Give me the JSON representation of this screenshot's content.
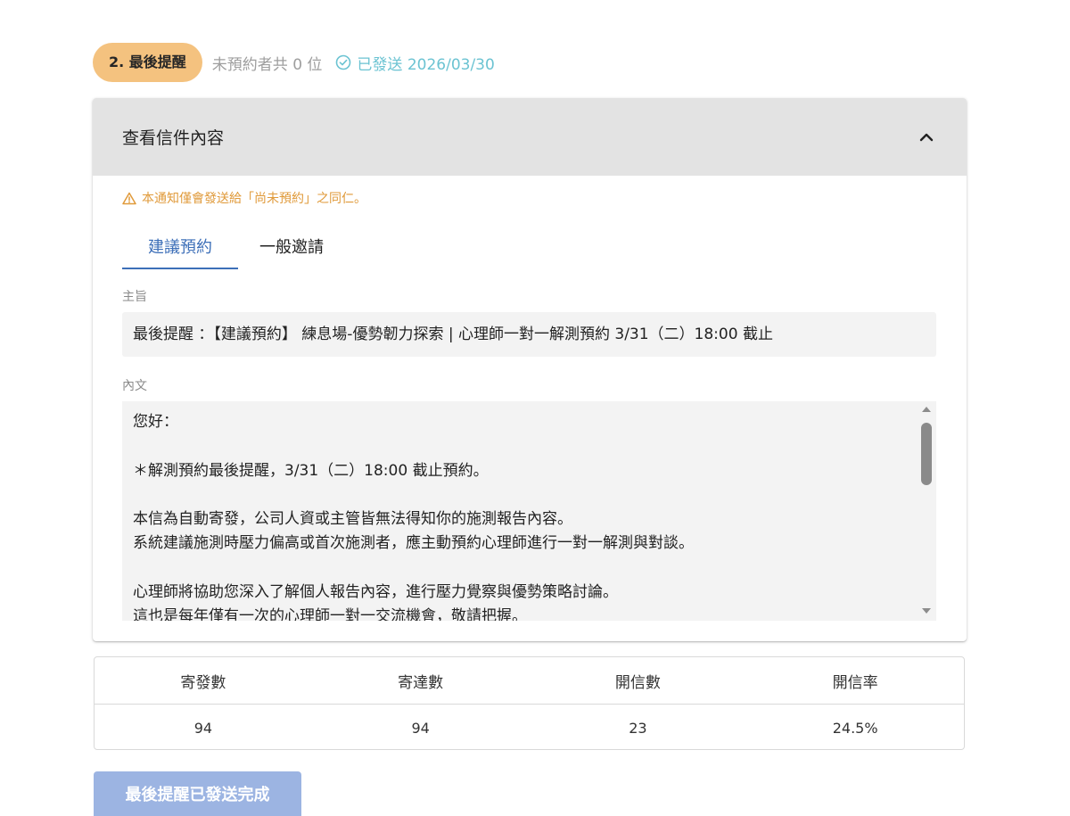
{
  "status": {
    "step_label": "2. 最後提醒",
    "pending_text": "未預約者共 0 位",
    "sent_text": "已發送 2026/03/30",
    "badge_color": "#f4c27f",
    "sent_color": "#6bc3d2"
  },
  "panel": {
    "title": "查看信件內容",
    "warning": "本通知僅會發送給「尚未預約」之同仁。",
    "tabs": [
      {
        "label": "建議預約",
        "active": true
      },
      {
        "label": "一般邀請",
        "active": false
      }
    ],
    "subject_label": "主旨",
    "subject_value": "最後提醒 ：【建議預約】 練息場-優勢韌力探索 | 心理師一對一解測預約 3/31（二）18:00 截止",
    "body_label": "內文",
    "body_lines": [
      "您好：",
      "",
      "＊解測預約最後提醒，3/31（二）18:00 截止預約。",
      "",
      "本信為自動寄發，公司人資或主管皆無法得知你的施測報告內容。",
      "系統建議施測時壓力偏高或首次施測者，應主動預約心理師進行一對一解測與對談。",
      "",
      "心理師將協助您深入了解個人報告內容，進行壓力覺察與優勢策略討論。",
      "這也是每年僅有一次的心理師一對一交流機會，敬請把握。"
    ]
  },
  "stats": {
    "headers": [
      "寄發數",
      "寄達數",
      "開信數",
      "開信率"
    ],
    "values": [
      "94",
      "94",
      "23",
      "24.5%"
    ]
  },
  "button": {
    "label": "最後提醒已發送完成",
    "color": "#9cb4e2"
  },
  "accent_color": "#3d6fb8",
  "warning_color": "#e09a3a"
}
